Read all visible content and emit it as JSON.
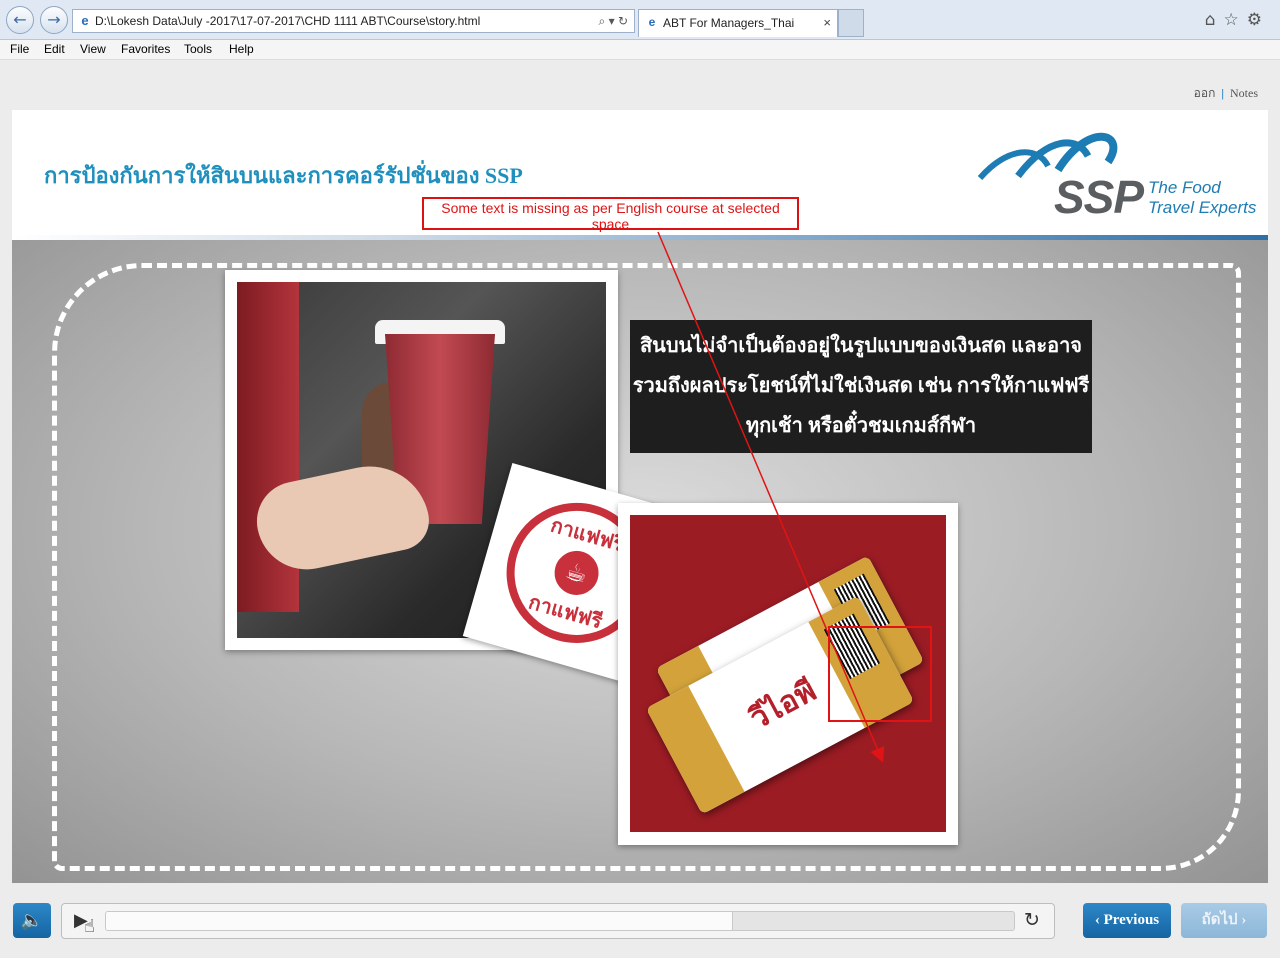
{
  "browser": {
    "back_icon": "back-arrow-icon",
    "forward_icon": "forward-arrow-icon",
    "address": "D:\\Lokesh Data\\July -2017\\17-07-2017\\CHD 1111 ABT\\Course\\story.html",
    "address_tools": "⌕ ▾ ↻",
    "tab_title": "ABT For Managers_Thai",
    "tab_close": "×",
    "right_icons": "⌂☆⚙"
  },
  "menu": {
    "items": [
      "File",
      "Edit",
      "View",
      "Favorites",
      "Tools",
      "Help"
    ]
  },
  "player": {
    "exit_label": "ออก",
    "notes_label": "Notes"
  },
  "slide": {
    "title": "การป้องกันการให้สินบนและการคอร์รัปชั่นของ SSP",
    "logo": {
      "brand": "SSP",
      "tagline_1": "The Food",
      "tagline_2": "Travel Experts"
    },
    "text_box": {
      "line1": "สินบนไม่จำเป็นต้องอยู่ในรูปแบบของเงินสด และอาจ",
      "line2": "รวมถึงผลประโยชน์ที่ไม่ใช่เงินสด เช่น การให้กาแฟฟรี",
      "line3": "ทุกเช้า หรือตั๋วชมเกมส์กีฬา"
    },
    "stamp_text": "กาแฟฟรี",
    "stamp_text_bottom": "กาแฟฟรี",
    "ticket_text": "วีไอพี"
  },
  "annotation": {
    "note": "Some text is missing as per English course at selected space",
    "color": "#e01414"
  },
  "controls": {
    "progress": 0.69,
    "previous_label": "Previous",
    "next_label": "ถัดไป",
    "accent": "#1b75b8"
  }
}
